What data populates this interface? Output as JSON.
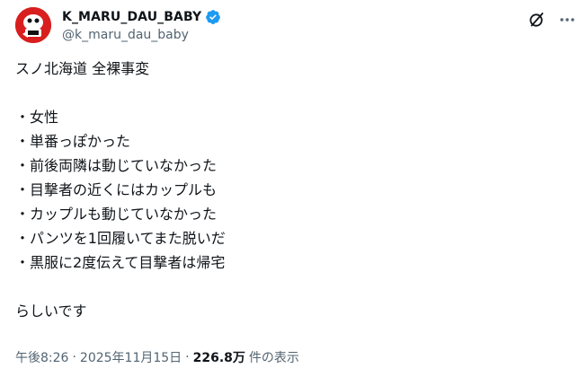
{
  "author": {
    "display_name": "K_MARU_DAU_BABY",
    "handle": "@k_maru_dau_baby",
    "verified": true,
    "avatar_colors": {
      "background": "#d81e1e",
      "figure": "#ffffff",
      "accent": "#111111"
    }
  },
  "header_actions": {
    "grok_icon": "grok-icon",
    "more_icon": "more-icon"
  },
  "tweet": {
    "lines": [
      "スノ北海道 全裸事変",
      "",
      "・女性",
      "・単番っぽかった",
      "・前後両隣は動じていなかった",
      "・目撃者の近くにはカップルも",
      "・カップルも動じていなかった",
      "・パンツを1回履いてまた脱いだ",
      "・黒服に2度伝えて目撃者は帰宅",
      "",
      "らしいです"
    ]
  },
  "meta": {
    "time": "午後8:26",
    "separator": "·",
    "date": "2025年11月15日",
    "views_count": "226.8万",
    "views_label": "件の表示"
  },
  "colors": {
    "text": "#0f1419",
    "secondary": "#536471",
    "verified_badge": "#1d9bf0"
  }
}
